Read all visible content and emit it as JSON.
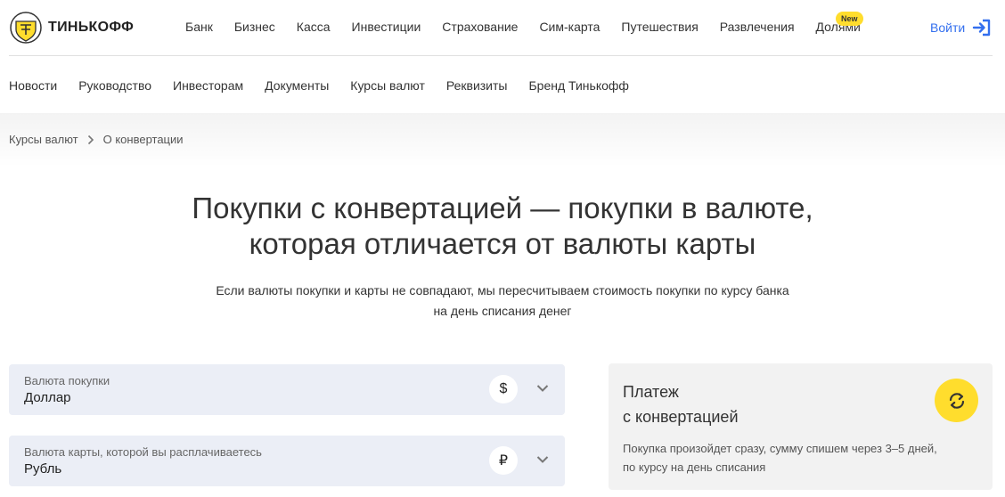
{
  "brand": {
    "name": "ТИНЬКОФФ"
  },
  "main_nav": {
    "items": [
      "Банк",
      "Бизнес",
      "Касса",
      "Инвестиции",
      "Страхование",
      "Сим-карта",
      "Путешествия",
      "Развлечения",
      "Долями"
    ],
    "badge": "New",
    "login_label": "Войти"
  },
  "sub_nav": {
    "items": [
      "Новости",
      "Руководство",
      "Инвесторам",
      "Документы",
      "Курсы валют",
      "Реквизиты",
      "Бренд Тинькофф"
    ]
  },
  "breadcrumb": {
    "items": [
      "Курсы валют",
      "О конвертации"
    ]
  },
  "hero": {
    "title_line1": "Покупки с конвертацией — покупки в валюте,",
    "title_line2": "которая отличается от валюты карты",
    "subtitle_line1": "Если валюты покупки и карты не совпадают, мы пересчитываем стоимость покупки по курсу банка",
    "subtitle_line2": "на день списания денег"
  },
  "purchase_currency": {
    "label": "Валюта покупки",
    "value": "Доллар",
    "symbol": "$"
  },
  "card_currency": {
    "label": "Валюта карты, которой вы расплачиваетесь",
    "value": "Рубль",
    "symbol": "₽"
  },
  "info_card": {
    "title_line1": "Платеж",
    "title_line2": "с конвертацией",
    "text_line1": "Покупка произойдет сразу, сумму спишем через 3–5 дней,",
    "text_line2": "по курсу на день списания"
  },
  "colors": {
    "accent_yellow": "#ffdd2d",
    "link_blue": "#336fee",
    "select_bg": "#ebeef6",
    "card_bg": "#f2f2f2"
  }
}
